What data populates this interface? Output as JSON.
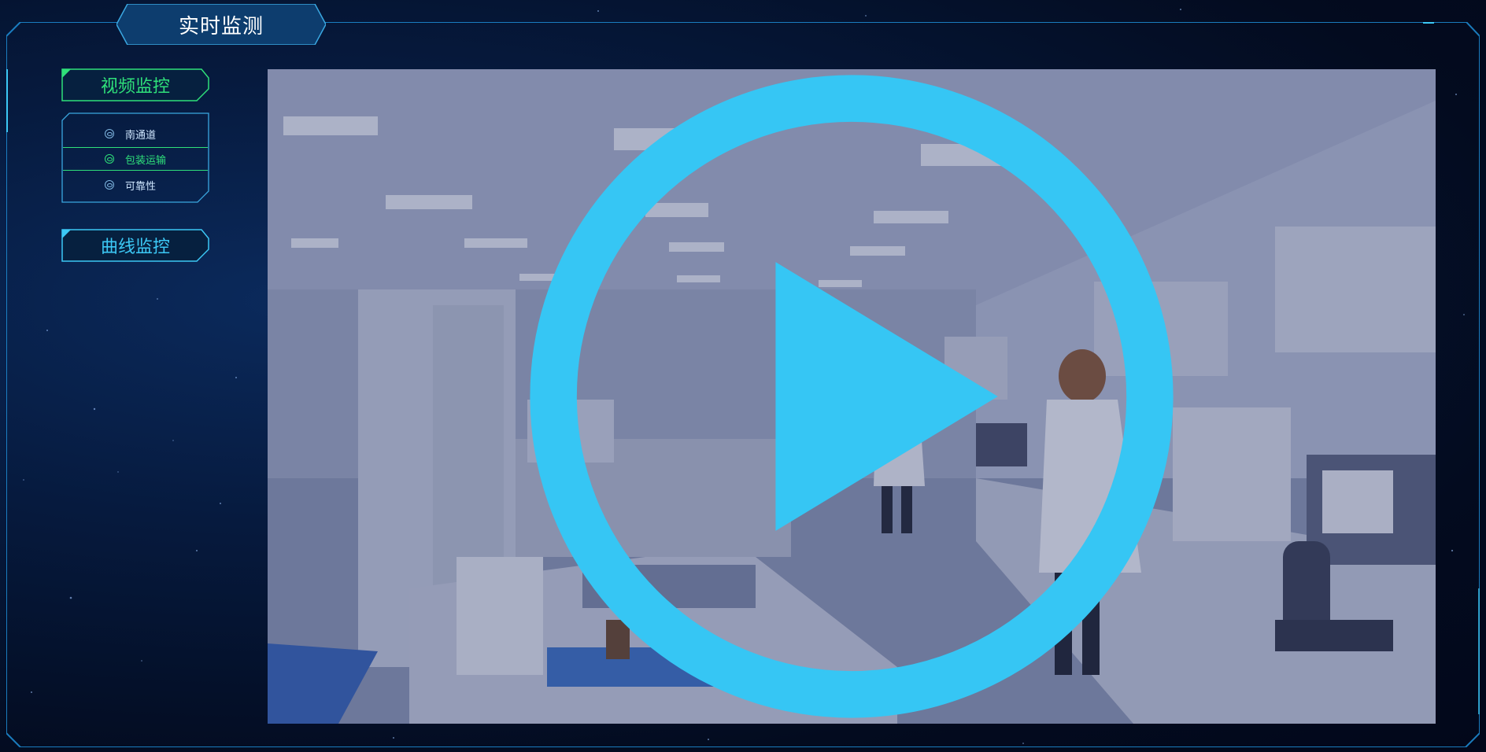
{
  "header": {
    "title": "实时监测"
  },
  "nav": {
    "video_label": "视频监控",
    "video_items": [
      {
        "label": "南通道",
        "active": false
      },
      {
        "label": "包装运输",
        "active": true
      },
      {
        "label": "可靠性",
        "active": false
      }
    ],
    "curve_label": "曲线监控"
  },
  "colors": {
    "accent_green": "#2fe07a",
    "accent_cyan": "#3cc8f5",
    "frame_blue": "#1f8fd8",
    "play_button": "#36c6f4"
  },
  "icons": {
    "item_icon": "circle-target-icon",
    "play": "play-icon"
  }
}
